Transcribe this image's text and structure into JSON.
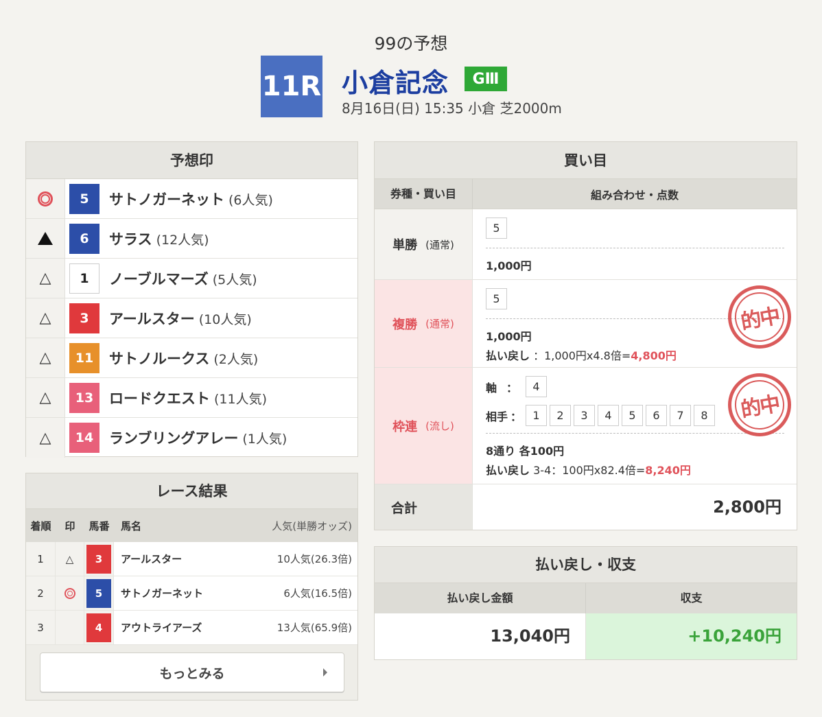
{
  "header": {
    "subtitle": "99の予想",
    "race_number": "11R",
    "race_name": "小倉記念",
    "grade": "GⅢ",
    "race_info": "8月16日(日) 15:35 小倉 芝2000m"
  },
  "prediction": {
    "title": "予想印",
    "rows": [
      {
        "mark": "double-circle",
        "num": "5",
        "color": "#2c4ea8",
        "name": "サトノガーネット",
        "pop": "(6人気)"
      },
      {
        "mark": "filled-triangle",
        "num": "6",
        "color": "#2c4ea8",
        "name": "サラス",
        "pop": "(12人気)"
      },
      {
        "mark": "open-triangle",
        "num": "1",
        "color": "#ffffff",
        "name": "ノーブルマーズ",
        "pop": "(5人気)"
      },
      {
        "mark": "open-triangle",
        "num": "3",
        "color": "#e0393c",
        "name": "アールスター",
        "pop": "(10人気)"
      },
      {
        "mark": "open-triangle",
        "num": "11",
        "color": "#e7902a",
        "name": "サトノルークス",
        "pop": "(2人気)"
      },
      {
        "mark": "open-triangle",
        "num": "13",
        "color": "#e8607a",
        "name": "ロードクエスト",
        "pop": "(11人気)"
      },
      {
        "mark": "open-triangle",
        "num": "14",
        "color": "#e8607a",
        "name": "ランブリングアレー",
        "pop": "(1人気)"
      }
    ],
    "open_triangle_glyph": "△"
  },
  "result": {
    "title": "レース結果",
    "headers": {
      "rank": "着順",
      "mark": "印",
      "num": "馬番",
      "name": "馬名",
      "odds": "人気(単勝オッズ)"
    },
    "rows": [
      {
        "rank": "1",
        "mark": "△",
        "num": "3",
        "color": "#e0393c",
        "name": "アールスター",
        "odds": "10人気(26.3倍)"
      },
      {
        "rank": "2",
        "mark": "double-circle",
        "num": "5",
        "color": "#2c4ea8",
        "name": "サトノガーネット",
        "odds": "6人気(16.5倍)"
      },
      {
        "rank": "3",
        "mark": "",
        "num": "4",
        "color": "#e0393c",
        "name": "アウトライアーズ",
        "odds": "13人気(65.9倍)"
      }
    ],
    "more_label": "もっとみる"
  },
  "bets": {
    "title": "買い目",
    "col_left": "券種・買い目",
    "col_right": "組み合わせ・点数",
    "win": {
      "label": "単勝",
      "sub": "(通常)",
      "pick": "5",
      "amount": "1,000円"
    },
    "place": {
      "label": "複勝",
      "sub": "(通常)",
      "pick": "5",
      "amount": "1,000円",
      "payout_label": "払い戻し",
      "payout_calc": "：1,000円x4.8倍=",
      "payout_value": "4,800円",
      "stamp": "的中"
    },
    "bracket": {
      "label": "枠連",
      "sub": "(流し)",
      "axis_label": "軸",
      "axis_sep": "：",
      "axis": "4",
      "partner_label": "相手",
      "partner_sep": "：",
      "partners": [
        "1",
        "2",
        "3",
        "4",
        "5",
        "6",
        "7",
        "8"
      ],
      "amount": "8通り 各100円",
      "payout_label": "払い戻し",
      "payout_combo": "3-4",
      "payout_calc": "：100円x82.4倍=",
      "payout_value": "8,240円",
      "stamp": "的中"
    },
    "total_label": "合計",
    "total_value": "2,800円"
  },
  "payout": {
    "title": "払い戻し・収支",
    "col_refund": "払い戻し金額",
    "col_profit": "収支",
    "refund": "13,040円",
    "profit": "+10,240円"
  }
}
